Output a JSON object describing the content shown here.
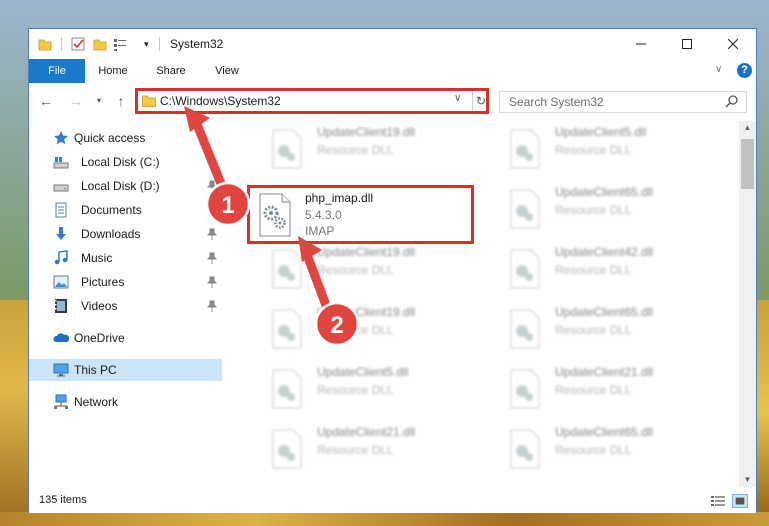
{
  "window": {
    "title": "System32"
  },
  "ribbon": {
    "file": "File",
    "home": "Home",
    "share": "Share",
    "view": "View",
    "help": "?"
  },
  "navbar": {
    "address": "C:\\Windows\\System32",
    "search_placeholder": "Search System32"
  },
  "sidebar": {
    "items": [
      {
        "label": "Quick access",
        "icon": "star-icon",
        "pinned": false
      },
      {
        "label": "Local Disk (C:)",
        "icon": "drive-c-icon",
        "pinned": true
      },
      {
        "label": "Local Disk (D:)",
        "icon": "drive-icon",
        "pinned": true
      },
      {
        "label": "Documents",
        "icon": "documents-icon",
        "pinned": true
      },
      {
        "label": "Downloads",
        "icon": "downloads-icon",
        "pinned": true
      },
      {
        "label": "Music",
        "icon": "music-icon",
        "pinned": true
      },
      {
        "label": "Pictures",
        "icon": "pictures-icon",
        "pinned": true
      },
      {
        "label": "Videos",
        "icon": "videos-icon",
        "pinned": true
      },
      {
        "label": "OneDrive",
        "icon": "onedrive-icon",
        "pinned": false
      },
      {
        "label": "This PC",
        "icon": "this-pc-icon",
        "pinned": false,
        "selected": true
      },
      {
        "label": "Network",
        "icon": "network-icon",
        "pinned": false
      }
    ]
  },
  "files": [
    {
      "name": "UpdateClient19.dll",
      "desc": "Resource DLL"
    },
    {
      "name": "UpdateClient5.dll",
      "desc": "Resource DLL"
    },
    {
      "name": "UpdateClient65.dll",
      "desc": "Resource DLL"
    },
    {
      "name": "UpdateClient19.dll",
      "desc": "Resource DLL"
    },
    {
      "name": "UpdateClient42.dll",
      "desc": "Resource DLL"
    },
    {
      "name": "UpdateClient19.dll",
      "desc": "Resource DLL"
    },
    {
      "name": "UpdateClient65.dll",
      "desc": "Resource DLL"
    },
    {
      "name": "UpdateClient5.dll",
      "desc": "Resource DLL"
    },
    {
      "name": "UpdateClient21.dll",
      "desc": "Resource DLL"
    },
    {
      "name": "UpdateClient21.dll",
      "desc": "Resource DLL"
    },
    {
      "name": "UpdateClient65.dll",
      "desc": "Resource DLL"
    }
  ],
  "focus_file": {
    "name": "php_imap.dll",
    "version": "5.4.3.0",
    "desc": "IMAP"
  },
  "status": {
    "item_count": "135 items"
  },
  "annotations": {
    "badge1": "1",
    "badge2": "2",
    "color": "#e0463f"
  }
}
